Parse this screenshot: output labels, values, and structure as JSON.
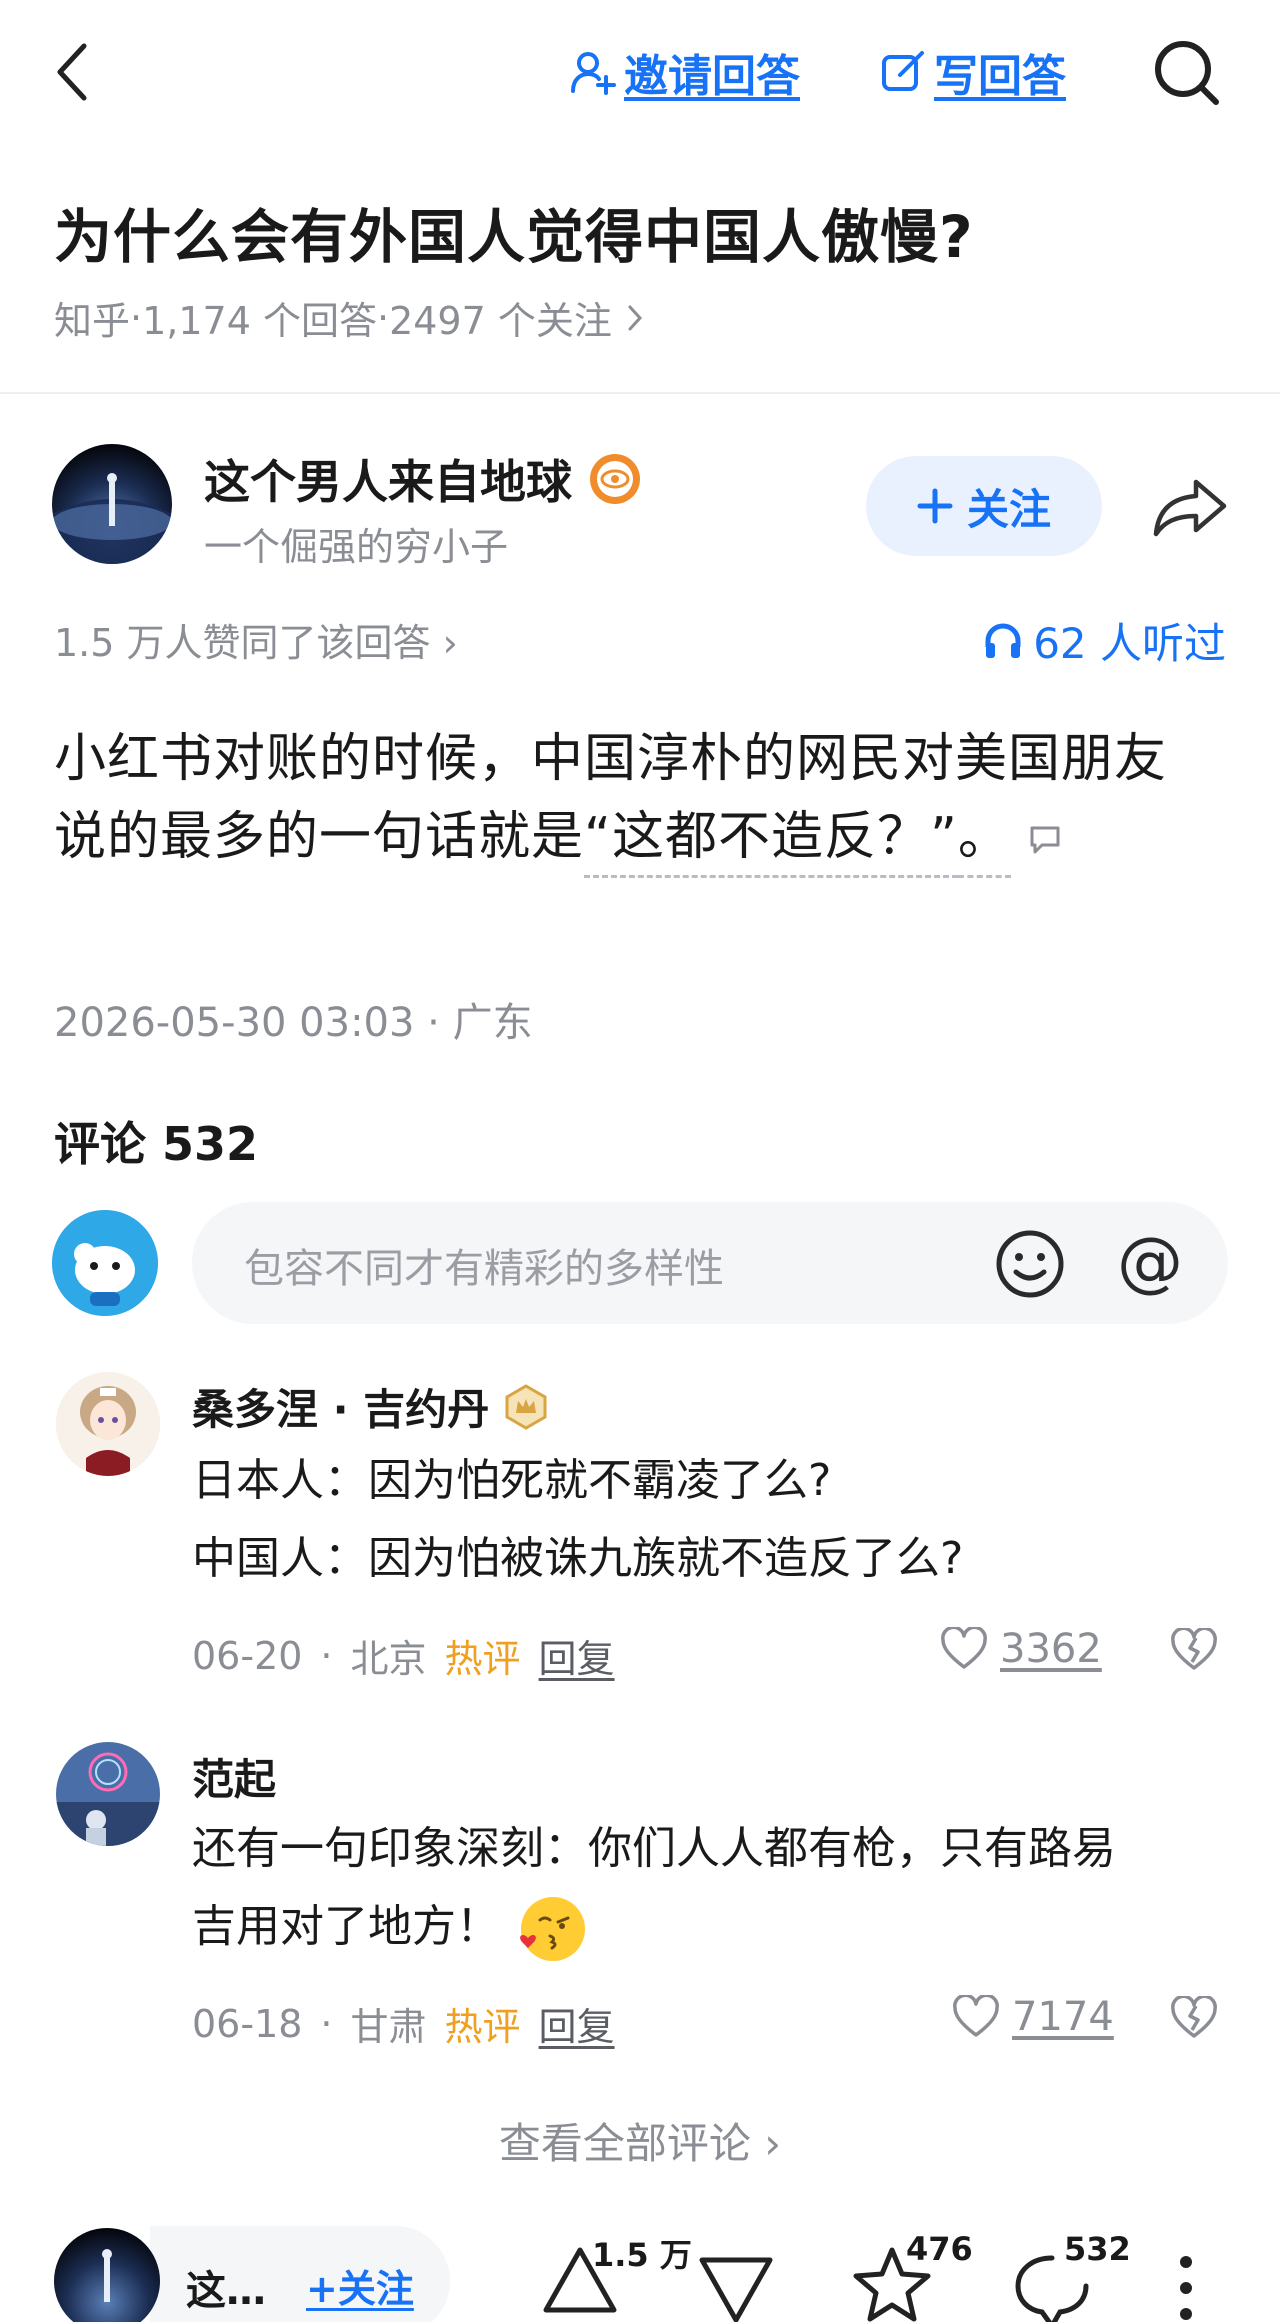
{
  "topbar": {
    "invite_label": "邀请回答",
    "write_label": "写回答"
  },
  "question": {
    "title": "为什么会有外国人觉得中国人傲慢?",
    "source": "知乎",
    "answer_count": "1,174 个回答",
    "follow_count": "2497 个关注",
    "sep": " · "
  },
  "author": {
    "name": "这个男人来自地球",
    "bio": "一个倔强的穷小子",
    "follow_label": "关注"
  },
  "answer": {
    "agree_text": "1.5 万人赞同了该回答 ›",
    "listened_text": "62 人听过",
    "body_line1": "小红书对账的时候，中国淳朴的网民对美国朋友",
    "body_line2_plain": "说的最多的一句话就是",
    "body_line2_quote": "“这都不造反？”",
    "body_line2_end": "。",
    "datetime": "2026-05-30 03:03 · 广东"
  },
  "comments": {
    "title": "评论 532",
    "placeholder": "包容不同才有精彩的多样性",
    "items": [
      {
        "name": "桑多涅 · 吉约丹",
        "line1": "日本人：因为怕死就不霸凌了么?",
        "line2": "中国人：因为怕被诛九族就不造反了么?",
        "date": "06-20",
        "location": "北京",
        "hot": "热评",
        "reply": "回复",
        "likes": "3362"
      },
      {
        "name": "范起",
        "line1": "还有一句印象深刻：你们人人都有枪，只有路易",
        "line2": "吉用对了地方！",
        "date": "06-18",
        "location": "甘肃",
        "hot": "热评",
        "reply": "回复",
        "likes": "7174"
      }
    ],
    "view_all": "查看全部评论 ›"
  },
  "bottombar": {
    "author_short": "这…",
    "follow_label": "+关注",
    "upvote_count": "1.5 万",
    "star_count": "476",
    "comment_count": "532"
  },
  "colors": {
    "accent": "#1772f6",
    "hot": "#f0a020",
    "muted": "#8a8d94"
  }
}
